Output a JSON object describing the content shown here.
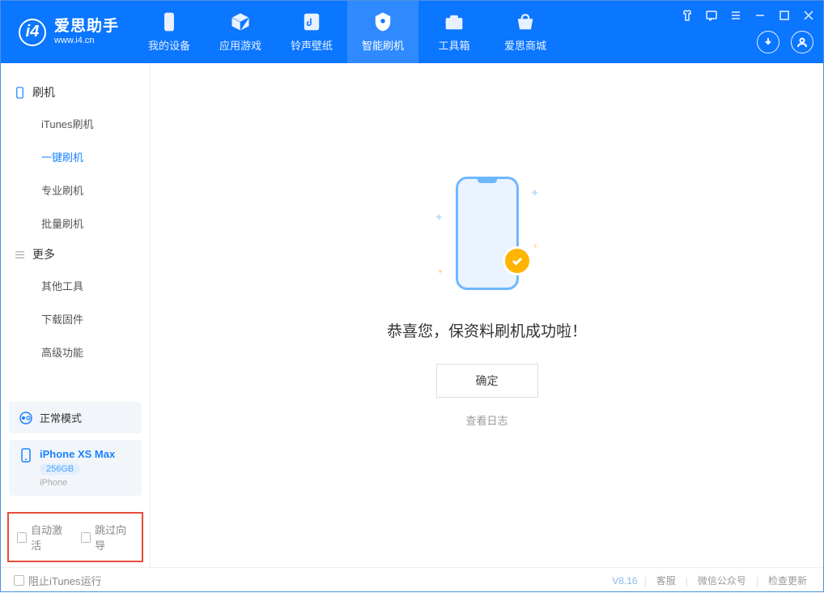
{
  "app": {
    "title": "爱思助手",
    "subtitle": "www.i4.cn"
  },
  "nav": {
    "tabs": [
      {
        "label": "我的设备",
        "icon": "device-icon"
      },
      {
        "label": "应用游戏",
        "icon": "cube-icon"
      },
      {
        "label": "铃声壁纸",
        "icon": "music-icon"
      },
      {
        "label": "智能刷机",
        "icon": "flash-icon"
      },
      {
        "label": "工具箱",
        "icon": "toolbox-icon"
      },
      {
        "label": "爱思商城",
        "icon": "shop-icon"
      }
    ]
  },
  "sidebar": {
    "group1_label": "刷机",
    "group1_items": [
      {
        "label": "iTunes刷机"
      },
      {
        "label": "一键刷机"
      },
      {
        "label": "专业刷机"
      },
      {
        "label": "批量刷机"
      }
    ],
    "group2_label": "更多",
    "group2_items": [
      {
        "label": "其他工具"
      },
      {
        "label": "下载固件"
      },
      {
        "label": "高级功能"
      }
    ]
  },
  "device": {
    "mode_label": "正常模式",
    "name": "iPhone XS Max",
    "storage": "256GB",
    "type": "iPhone"
  },
  "options": {
    "auto_activate": "自动激活",
    "skip_wizard": "跳过向导"
  },
  "main": {
    "success_message": "恭喜您，保资料刷机成功啦！",
    "ok_button": "确定",
    "view_log": "查看日志"
  },
  "footer": {
    "block_itunes": "阻止iTunes运行",
    "version": "V8.16",
    "support": "客服",
    "wechat": "微信公众号",
    "check_update": "检查更新"
  }
}
